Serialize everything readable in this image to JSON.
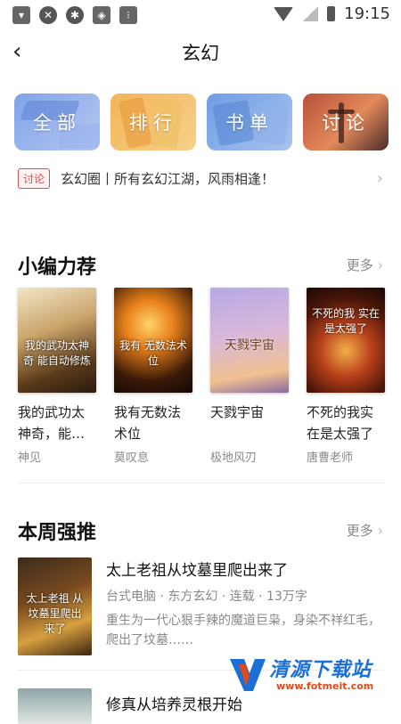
{
  "status_bar": {
    "time": "19:15",
    "left_icons": [
      "cup-icon",
      "close-circle-icon",
      "bug-icon",
      "shield-icon",
      "toggle-icon"
    ]
  },
  "header": {
    "title": "玄幻"
  },
  "categories": [
    {
      "label": "全部"
    },
    {
      "label": "排行"
    },
    {
      "label": "书单"
    },
    {
      "label": "讨论"
    }
  ],
  "discussion": {
    "badge": "讨论",
    "text": "玄幻圈丨所有玄幻江湖，风雨相逢！"
  },
  "editor_picks": {
    "title": "小编力荐",
    "more": "更多",
    "books": [
      {
        "name": "我的武功太神奇，能…",
        "author": "神见",
        "cover_text": "我的武功太神奇 能自动修炼"
      },
      {
        "name": "我有无数法术位",
        "author": "莫叹息",
        "cover_text": "我有 无数法术位"
      },
      {
        "name": "天戮宇宙",
        "author": "极地风刃",
        "cover_text": "天戮宇宙"
      },
      {
        "name": "不死的我实在是太强了",
        "author": "唐曹老师",
        "cover_text": "不死的我 实在是太强了"
      }
    ]
  },
  "weekly": {
    "title": "本周强推",
    "more": "更多",
    "items": [
      {
        "title": "太上老祖从坟墓里爬出来了",
        "meta": "台式电脑 · 东方玄幻 · 连载 · 13万字",
        "desc": "重生为一代心狠手辣的魔道巨枭，身染不祥红毛，爬出了坟墓……",
        "cover_text": "太上老祖 从坟墓里爬出来了"
      },
      {
        "title": "修真从培养灵根开始"
      }
    ]
  },
  "watermark": {
    "text": "清源下载站",
    "url": "www.fotmeit.com"
  }
}
